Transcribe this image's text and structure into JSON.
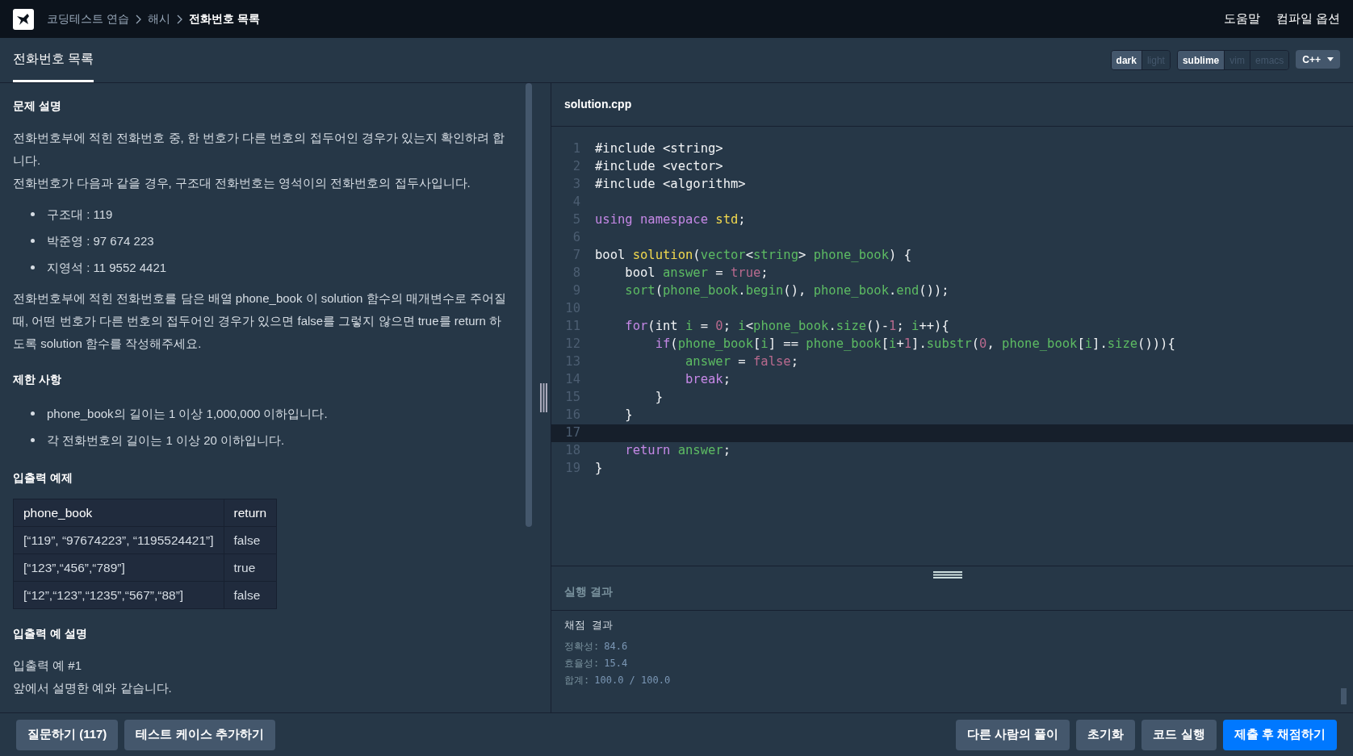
{
  "breadcrumb": [
    {
      "label": "코딩테스트 연습",
      "current": false
    },
    {
      "label": "해시",
      "current": false
    },
    {
      "label": "전화번호 목록",
      "current": true
    }
  ],
  "top_links": [
    "도움말",
    "컴파일 옵션"
  ],
  "tab": {
    "label": "전화번호 목록",
    "selected": true
  },
  "toggles": [
    [
      {
        "label": "dark",
        "selected": true
      },
      {
        "label": "light",
        "selected": false
      }
    ],
    [
      {
        "label": "sublime",
        "selected": true
      },
      {
        "label": "vim",
        "selected": false
      },
      {
        "label": "emacs",
        "selected": false
      }
    ]
  ],
  "language": "C++",
  "description": [
    {
      "kind": "heading",
      "text": "문제 설명"
    },
    {
      "kind": "paragraph",
      "lines": [
        "전화번호부에 적힌 전화번호 중, 한 번호가 다른 번호의 접두어인 경우가 있는지 확인하려 합니다.",
        "전화번호가 다음과 같을 경우, 구조대 전화번호는 영석이의 전화번호의 접두사입니다."
      ]
    },
    {
      "kind": "bullets",
      "items": [
        "구조대 : 119",
        "박준영 : 97 674 223",
        "지영석 : 11 9552 4421"
      ]
    },
    {
      "kind": "paragraph",
      "lines": [
        "전화번호부에 적힌 전화번호를 담은 배열 phone_book 이 solution 함수의 매개변수로 주어질 때, 어떤 번호가 다른 번호의 접두어인 경우가 있으면 false를 그렇지 않으면 true를 return 하도록 solution 함수를 작성해주세요."
      ]
    },
    {
      "kind": "heading",
      "text": "제한 사항"
    },
    {
      "kind": "bullets",
      "items": [
        "phone_book의 길이는 1 이상 1,000,000 이하입니다.",
        "각 전화번호의 길이는 1 이상 20 이하입니다."
      ]
    },
    {
      "kind": "heading",
      "text": "입출력 예제"
    },
    {
      "kind": "table",
      "columns": [
        "phone_book",
        "return"
      ],
      "rows": [
        [
          "[“119”, “97674223”, “1195524421”]",
          "false"
        ],
        [
          "[“123”,“456”,“789”]",
          "true"
        ],
        [
          "[“12”,“123”,“1235”,“567”,“88”]",
          "false"
        ]
      ]
    },
    {
      "kind": "heading",
      "text": "입출력 예 설명"
    },
    {
      "kind": "paragraph",
      "lines": [
        "입출력 예 #1",
        "앞에서 설명한 예와 같습니다."
      ]
    }
  ],
  "editor": {
    "filename": "solution.cpp",
    "lines": [
      {
        "number": "1",
        "active": false,
        "tokens": [
          {
            "kind": "plain",
            "text": "#include <string>"
          }
        ]
      },
      {
        "number": "2",
        "active": false,
        "tokens": [
          {
            "kind": "plain",
            "text": "#include <vector>"
          }
        ]
      },
      {
        "number": "3",
        "active": false,
        "tokens": [
          {
            "kind": "plain",
            "text": "#include <algorithm>"
          }
        ]
      },
      {
        "number": "4",
        "active": false
      },
      {
        "number": "5",
        "active": false,
        "tokens": [
          {
            "kind": "keyword",
            "text": "using namespace "
          },
          {
            "kind": "function",
            "text": "std"
          },
          {
            "kind": "plain",
            "text": ";"
          }
        ]
      },
      {
        "number": "6",
        "active": false
      },
      {
        "number": "7",
        "active": false,
        "tokens": [
          {
            "kind": "plain",
            "text": "bool "
          },
          {
            "kind": "function",
            "text": "solution"
          },
          {
            "kind": "plain",
            "text": "("
          },
          {
            "kind": "variable",
            "text": "vector"
          },
          {
            "kind": "plain",
            "text": "<"
          },
          {
            "kind": "variable",
            "text": "string"
          },
          {
            "kind": "plain",
            "text": "> "
          },
          {
            "kind": "variable",
            "text": "phone_book"
          },
          {
            "kind": "plain",
            "text": ") {"
          }
        ]
      },
      {
        "number": "8",
        "active": false,
        "tokens": [
          {
            "kind": "plain",
            "text": "    bool "
          },
          {
            "kind": "variable",
            "text": "answer"
          },
          {
            "kind": "plain",
            "text": " = "
          },
          {
            "kind": "literal",
            "text": "true"
          },
          {
            "kind": "plain",
            "text": ";"
          }
        ]
      },
      {
        "number": "9",
        "active": false,
        "tokens": [
          {
            "kind": "variable",
            "text": "    sort"
          },
          {
            "kind": "plain",
            "text": "("
          },
          {
            "kind": "variable",
            "text": "phone_book"
          },
          {
            "kind": "plain",
            "text": "."
          },
          {
            "kind": "variable",
            "text": "begin"
          },
          {
            "kind": "plain",
            "text": "(), "
          },
          {
            "kind": "variable",
            "text": "phone_book"
          },
          {
            "kind": "plain",
            "text": "."
          },
          {
            "kind": "variable",
            "text": "end"
          },
          {
            "kind": "plain",
            "text": "());"
          }
        ]
      },
      {
        "number": "10",
        "active": false
      },
      {
        "number": "11",
        "active": false,
        "tokens": [
          {
            "kind": "keyword",
            "text": "    for"
          },
          {
            "kind": "plain",
            "text": "(int "
          },
          {
            "kind": "variable",
            "text": "i"
          },
          {
            "kind": "plain",
            "text": " = "
          },
          {
            "kind": "literal",
            "text": "0"
          },
          {
            "kind": "plain",
            "text": "; "
          },
          {
            "kind": "variable",
            "text": "i"
          },
          {
            "kind": "plain",
            "text": "<"
          },
          {
            "kind": "variable",
            "text": "phone_book"
          },
          {
            "kind": "plain",
            "text": "."
          },
          {
            "kind": "variable",
            "text": "size"
          },
          {
            "kind": "plain",
            "text": "()-"
          },
          {
            "kind": "literal",
            "text": "1"
          },
          {
            "kind": "plain",
            "text": "; "
          },
          {
            "kind": "variable",
            "text": "i"
          },
          {
            "kind": "plain",
            "text": "++){"
          }
        ]
      },
      {
        "number": "12",
        "active": false,
        "tokens": [
          {
            "kind": "keyword",
            "text": "        if"
          },
          {
            "kind": "plain",
            "text": "("
          },
          {
            "kind": "variable",
            "text": "phone_book"
          },
          {
            "kind": "plain",
            "text": "["
          },
          {
            "kind": "variable",
            "text": "i"
          },
          {
            "kind": "plain",
            "text": "] == "
          },
          {
            "kind": "variable",
            "text": "phone_book"
          },
          {
            "kind": "plain",
            "text": "["
          },
          {
            "kind": "variable",
            "text": "i"
          },
          {
            "kind": "plain",
            "text": "+"
          },
          {
            "kind": "literal",
            "text": "1"
          },
          {
            "kind": "plain",
            "text": "]."
          },
          {
            "kind": "variable",
            "text": "substr"
          },
          {
            "kind": "plain",
            "text": "("
          },
          {
            "kind": "literal",
            "text": "0"
          },
          {
            "kind": "plain",
            "text": ", "
          },
          {
            "kind": "variable",
            "text": "phone_book"
          },
          {
            "kind": "plain",
            "text": "["
          },
          {
            "kind": "variable",
            "text": "i"
          },
          {
            "kind": "plain",
            "text": "]."
          },
          {
            "kind": "variable",
            "text": "size"
          },
          {
            "kind": "plain",
            "text": "())){"
          }
        ]
      },
      {
        "number": "13",
        "active": false,
        "tokens": [
          {
            "kind": "variable",
            "text": "            answer"
          },
          {
            "kind": "plain",
            "text": " = "
          },
          {
            "kind": "literal",
            "text": "false"
          },
          {
            "kind": "plain",
            "text": ";"
          }
        ]
      },
      {
        "number": "14",
        "active": false,
        "tokens": [
          {
            "kind": "keyword",
            "text": "            break"
          },
          {
            "kind": "plain",
            "text": ";"
          }
        ]
      },
      {
        "number": "15",
        "active": false,
        "tokens": [
          {
            "kind": "plain",
            "text": "        }"
          }
        ]
      },
      {
        "number": "16",
        "active": false,
        "tokens": [
          {
            "kind": "plain",
            "text": "    }"
          }
        ]
      },
      {
        "number": "17",
        "active": true
      },
      {
        "number": "18",
        "active": false,
        "tokens": [
          {
            "kind": "keyword",
            "text": "    return "
          },
          {
            "kind": "variable",
            "text": "answer"
          },
          {
            "kind": "plain",
            "text": ";"
          }
        ]
      },
      {
        "number": "19",
        "active": false,
        "tokens": [
          {
            "kind": "plain",
            "text": "}"
          }
        ]
      }
    ]
  },
  "results": {
    "title": "실행 결과",
    "heading": "채점 결과",
    "lines": [
      {
        "label": "정확성:",
        "value": "84.6"
      },
      {
        "label": "효율성:",
        "value": "15.4"
      },
      {
        "label": "합계:",
        "value": "100.0 / 100.0"
      }
    ]
  },
  "footer_left": [
    {
      "label": "질문하기 (117)",
      "kind": "secondary"
    },
    {
      "label": "테스트 케이스 추가하기",
      "kind": "secondary"
    }
  ],
  "footer_right": [
    {
      "label": "다른 사람의 풀이",
      "kind": "secondary"
    },
    {
      "label": "초기화",
      "kind": "secondary"
    },
    {
      "label": "코드 실행",
      "kind": "secondary"
    },
    {
      "label": "제출 후 채점하기",
      "kind": "primary"
    }
  ]
}
